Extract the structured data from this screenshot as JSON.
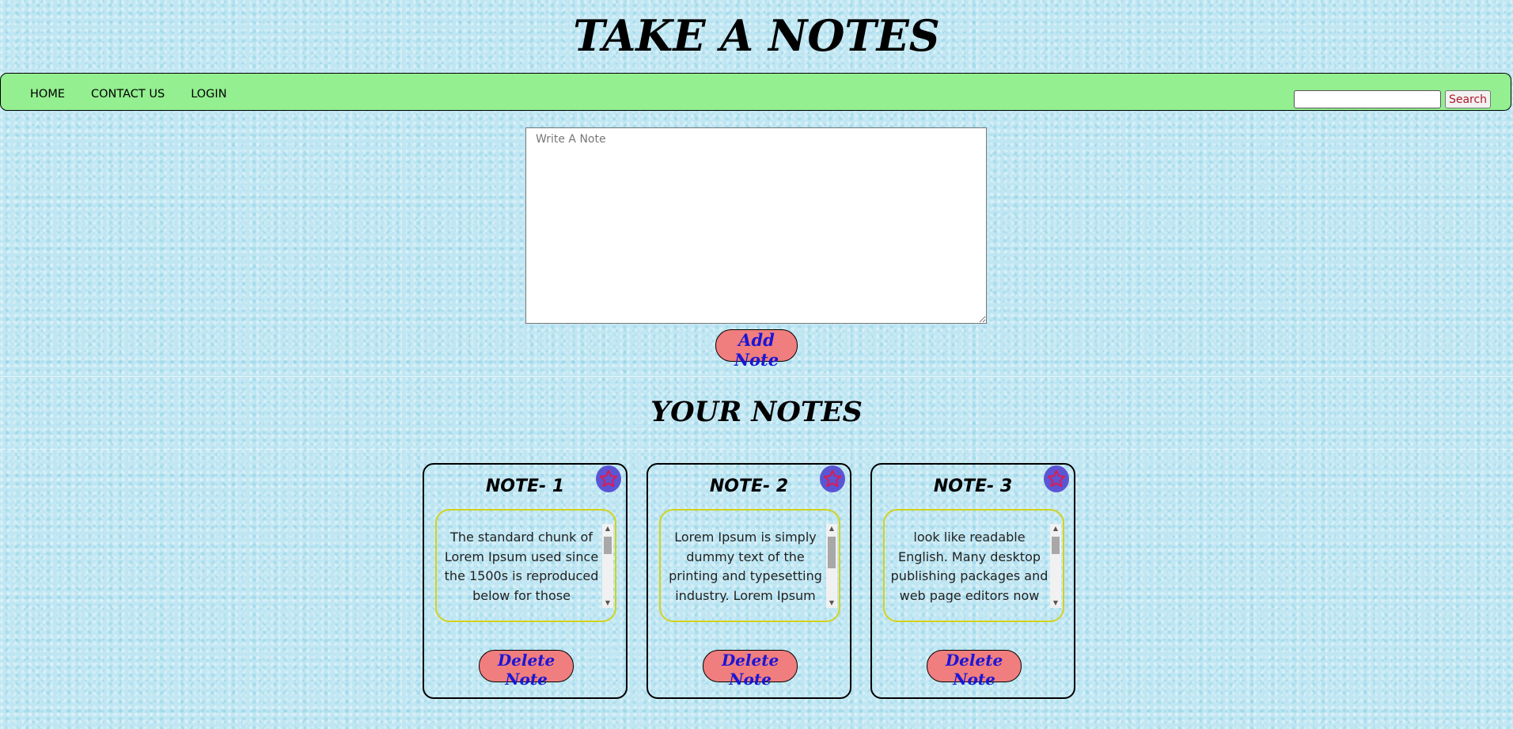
{
  "page": {
    "title": "TAKE A NOTES",
    "section_heading": "YOUR NOTES"
  },
  "nav": {
    "items": [
      {
        "label": "HOME"
      },
      {
        "label": "CONTACT US"
      },
      {
        "label": "LOGIN"
      }
    ],
    "search": {
      "value": "",
      "placeholder": "",
      "button_label": "Search"
    }
  },
  "composer": {
    "placeholder": "Write A Note",
    "value": "",
    "add_label": "Add Note"
  },
  "notes": [
    {
      "title": "NOTE- 1",
      "text": "The standard chunk of Lorem Ipsum used since the 1500s is reproduced below for those interested.",
      "delete_label": "Delete Note",
      "icon": "star-icon"
    },
    {
      "title": "NOTE- 2",
      "text": "Lorem Ipsum is simply dummy text of the printing and typesetting industry. Lorem Ipsum has been the industry's standard.",
      "delete_label": "Delete Note",
      "icon": "star-icon"
    },
    {
      "title": "NOTE- 3",
      "text": "look like readable English. Many desktop publishing packages and web page editors now use Lorem Ipsum.",
      "delete_label": "Delete Note",
      "icon": "star-icon"
    }
  ],
  "colors": {
    "navbar": "#93ef90",
    "button_bg": "#f07e7e",
    "button_text": "#1a16d6",
    "note_border": "#d3d21c",
    "star_bg": "#5b55d4",
    "star_outline": "#e01a4f",
    "search_text": "#b0182b"
  }
}
